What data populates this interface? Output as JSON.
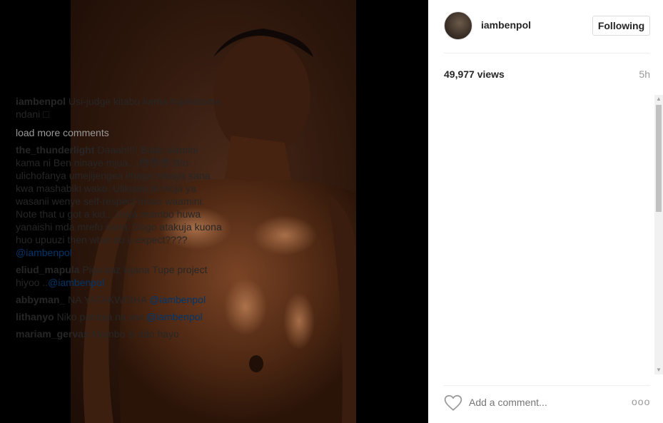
{
  "post": {
    "username": "iambenpol",
    "follow_label": "Following",
    "views": "49,977 views",
    "time": "5h",
    "add_comment_placeholder": "Add a comment...",
    "more_label": "ooo"
  },
  "caption": {
    "user": "iambenpol",
    "text": "Usi-judge kitabu kama hujakisoma ndani □"
  },
  "load_more": "load more comments",
  "comments": [
    {
      "user": "the_thunderlight",
      "text": "Daaah!!!! Bado siamini kama ni Ben ninaye mjua....😳😳😳 Bro ulichofanya umejijengea image mbaya sana kwa mashabiki wako. Ulikuwa ni moja ya wasanii wenye self-respect ninao waamini. Note that u got a kid....haya mambo huwa yanaishi mda mrefu sana. Dogo atakuja kuona huo upuuzi then what do u expect????",
      "mention": "@iambenpol"
    },
    {
      "user": "eliud_mapula",
      "text": "Piga kaz kijana Tupe project hiyoo ..",
      "mention": "@iambenpol"
    },
    {
      "user": "abbyman_",
      "text": "NA YATAKWISHA",
      "mention": "@iambenpol"
    },
    {
      "user": "lithanyo",
      "text": "Niko pamoja na ww",
      "mention": "@iambenpol"
    },
    {
      "user": "mariam_gervas",
      "text": "Mambo si ndo hayo",
      "mention": ""
    }
  ],
  "icons": {
    "heart": "heart-icon",
    "scroll_up": "▲",
    "scroll_down": "▼"
  },
  "colors": {
    "mention": "#003569",
    "muted": "#999999",
    "border": "#dbdbdb"
  }
}
